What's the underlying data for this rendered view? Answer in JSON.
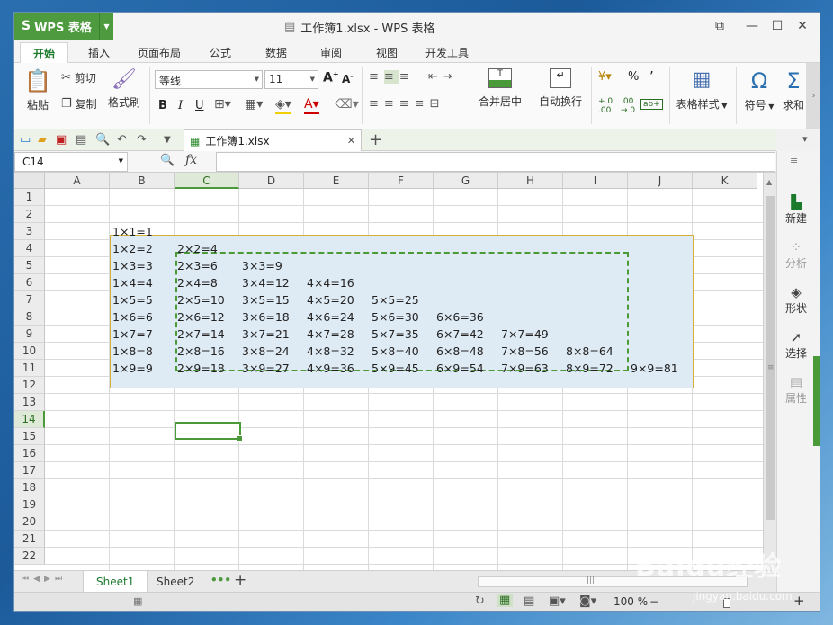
{
  "app": {
    "name": "WPS 表格",
    "window_title": "工作簿1.xlsx - WPS 表格"
  },
  "tabs": [
    "开始",
    "插入",
    "页面布局",
    "公式",
    "数据",
    "审阅",
    "视图",
    "开发工具"
  ],
  "ribbon": {
    "paste": "粘贴",
    "cut": "剪切",
    "copy": "复制",
    "format_painter": "格式刷",
    "font_name": "等线",
    "font_size": "11",
    "merge_center": "合并居中",
    "wrap_text": "自动换行",
    "table_style": "表格样式",
    "symbol": "符号",
    "sum": "求和",
    "percent": "%",
    "comma": "’"
  },
  "doc_tab": "工作簿1.xlsx",
  "name_box": "C14",
  "fx_label": "fx",
  "columns": [
    "A",
    "B",
    "C",
    "D",
    "E",
    "F",
    "G",
    "H",
    "I",
    "J",
    "K"
  ],
  "rows": [
    "1",
    "2",
    "3",
    "4",
    "5",
    "6",
    "7",
    "8",
    "9",
    "10",
    "11",
    "12",
    "13",
    "14",
    "15",
    "16",
    "17",
    "18",
    "19",
    "20",
    "21",
    "22"
  ],
  "cells": [
    {
      "row": 3,
      "col": "B",
      "text": "1×1=1"
    },
    {
      "row": 4,
      "col": "B",
      "text": "1×2=2"
    },
    {
      "row": 4,
      "col": "C",
      "text": "2×2=4"
    },
    {
      "row": 5,
      "col": "B",
      "text": "1×3=3"
    },
    {
      "row": 5,
      "col": "C",
      "text": "2×3=6"
    },
    {
      "row": 5,
      "col": "D",
      "text": "3×3=9"
    },
    {
      "row": 6,
      "col": "B",
      "text": "1×4=4"
    },
    {
      "row": 6,
      "col": "C",
      "text": "2×4=8"
    },
    {
      "row": 6,
      "col": "D",
      "text": "3×4=12"
    },
    {
      "row": 6,
      "col": "E",
      "text": "4×4=16"
    },
    {
      "row": 7,
      "col": "B",
      "text": "1×5=5"
    },
    {
      "row": 7,
      "col": "C",
      "text": "2×5=10"
    },
    {
      "row": 7,
      "col": "D",
      "text": "3×5=15"
    },
    {
      "row": 7,
      "col": "E",
      "text": "4×5=20"
    },
    {
      "row": 7,
      "col": "F",
      "text": "5×5=25"
    },
    {
      "row": 8,
      "col": "B",
      "text": "1×6=6"
    },
    {
      "row": 8,
      "col": "C",
      "text": "2×6=12"
    },
    {
      "row": 8,
      "col": "D",
      "text": "3×6=18"
    },
    {
      "row": 8,
      "col": "E",
      "text": "4×6=24"
    },
    {
      "row": 8,
      "col": "F",
      "text": "5×6=30"
    },
    {
      "row": 8,
      "col": "G",
      "text": "6×6=36"
    },
    {
      "row": 9,
      "col": "B",
      "text": "1×7=7"
    },
    {
      "row": 9,
      "col": "C",
      "text": "2×7=14"
    },
    {
      "row": 9,
      "col": "D",
      "text": "3×7=21"
    },
    {
      "row": 9,
      "col": "E",
      "text": "4×7=28"
    },
    {
      "row": 9,
      "col": "F",
      "text": "5×7=35"
    },
    {
      "row": 9,
      "col": "G",
      "text": "6×7=42"
    },
    {
      "row": 9,
      "col": "H",
      "text": "7×7=49"
    },
    {
      "row": 10,
      "col": "B",
      "text": "1×8=8"
    },
    {
      "row": 10,
      "col": "C",
      "text": "2×8=16"
    },
    {
      "row": 10,
      "col": "D",
      "text": "3×8=24"
    },
    {
      "row": 10,
      "col": "E",
      "text": "4×8=32"
    },
    {
      "row": 10,
      "col": "F",
      "text": "5×8=40"
    },
    {
      "row": 10,
      "col": "G",
      "text": "6×8=48"
    },
    {
      "row": 10,
      "col": "H",
      "text": "7×8=56"
    },
    {
      "row": 10,
      "col": "I",
      "text": "8×8=64"
    },
    {
      "row": 11,
      "col": "B",
      "text": "1×9=9"
    },
    {
      "row": 11,
      "col": "C",
      "text": "2×9=18"
    },
    {
      "row": 11,
      "col": "D",
      "text": "3×9=27"
    },
    {
      "row": 11,
      "col": "E",
      "text": "4×9=36"
    },
    {
      "row": 11,
      "col": "F",
      "text": "5×9=45"
    },
    {
      "row": 11,
      "col": "G",
      "text": "6×9=54"
    },
    {
      "row": 11,
      "col": "H",
      "text": "7×9=63"
    },
    {
      "row": 11,
      "col": "I",
      "text": "8×9=72"
    },
    {
      "row": 11,
      "col": "J",
      "text": "9×9=81"
    }
  ],
  "sheets": [
    "Sheet1",
    "Sheet2"
  ],
  "right_pane": [
    "新建",
    "分析",
    "形状",
    "选择",
    "属性"
  ],
  "status": {
    "zoom": "100 %"
  },
  "watermark": {
    "main": "Baidu经验",
    "sub": "jingyan.baidu.com"
  },
  "colors": {
    "accent": "#4a9a3a",
    "selection": "#deeaf4"
  }
}
